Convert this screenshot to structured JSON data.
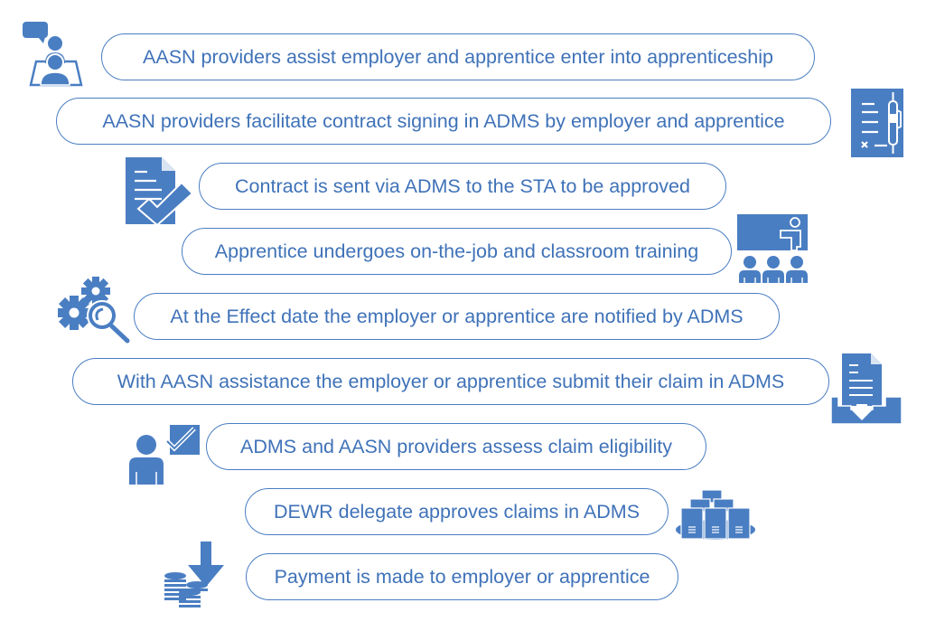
{
  "diagram": {
    "accent_color": "#4a7ec2",
    "steps": [
      {
        "label": "AASN providers assist employer and apprentice enter into apprenticeship",
        "icon": "meeting-icon"
      },
      {
        "label": "AASN providers facilitate contract signing in ADMS by employer and apprentice",
        "icon": "contract-pen-icon"
      },
      {
        "label": "Contract is sent via ADMS to the STA to be approved",
        "icon": "document-check-icon"
      },
      {
        "label": "Apprentice undergoes on-the-job and classroom training",
        "icon": "classroom-icon"
      },
      {
        "label": "At the Effect date the employer or apprentice are notified by ADMS",
        "icon": "gears-magnifier-icon"
      },
      {
        "label": "With AASN assistance the employer or apprentice submit their claim in ADMS",
        "icon": "document-inbox-icon"
      },
      {
        "label": "ADMS and AASN providers assess claim eligibility",
        "icon": "person-check-icon"
      },
      {
        "label": "DEWR delegate approves claims in ADMS",
        "icon": "servers-icon"
      },
      {
        "label": "Payment is made to employer or apprentice",
        "icon": "coins-down-icon"
      }
    ]
  }
}
